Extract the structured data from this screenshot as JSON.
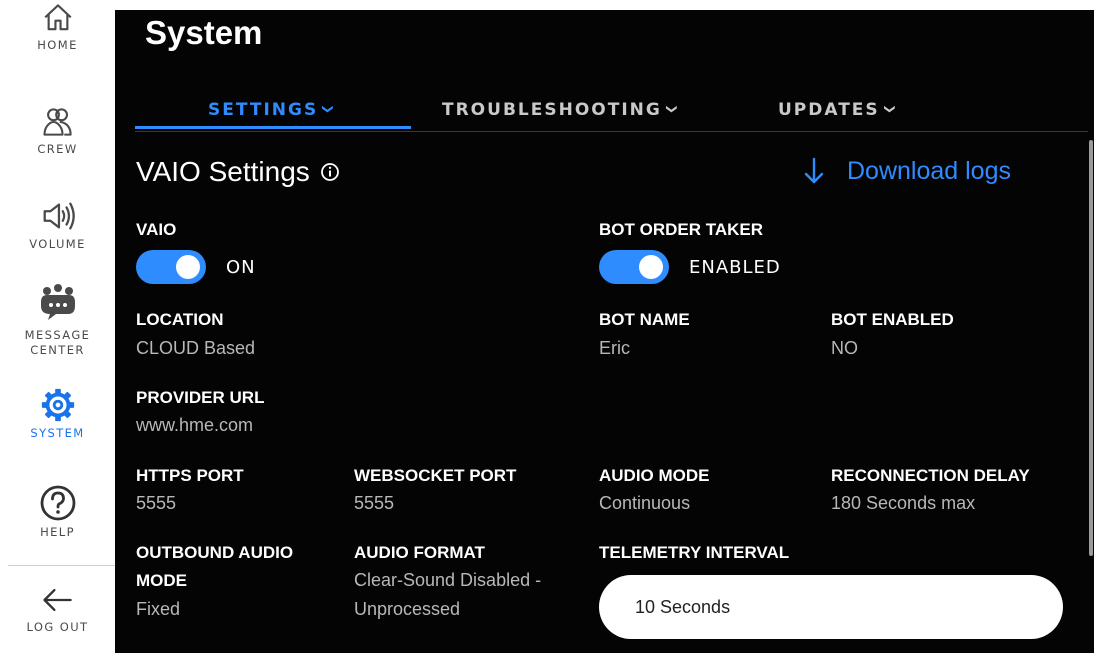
{
  "sidebar": {
    "items": [
      {
        "label": "HOME",
        "icon": "home-icon"
      },
      {
        "label": "CREW",
        "icon": "crew-icon"
      },
      {
        "label": "VOLUME",
        "icon": "volume-icon"
      },
      {
        "label_line1": "MESSAGE",
        "label_line2": "CENTER",
        "icon": "message-center-icon"
      },
      {
        "label": "SYSTEM",
        "icon": "gear-icon",
        "active": true
      },
      {
        "label": "HELP",
        "icon": "help-icon"
      },
      {
        "label": "LOG OUT",
        "icon": "arrow-left-icon"
      }
    ]
  },
  "header": {
    "title": "System"
  },
  "tabs": [
    {
      "label": "SETTINGS",
      "active": true
    },
    {
      "label": "TROUBLESHOOTING"
    },
    {
      "label": "UPDATES"
    }
  ],
  "section": {
    "title": "VAIO Settings",
    "download_label": "Download logs"
  },
  "vaio": {
    "label": "VAIO",
    "state": "ON"
  },
  "bot_order_taker": {
    "label": "BOT ORDER TAKER",
    "state": "ENABLED"
  },
  "location": {
    "label": "LOCATION",
    "value": "CLOUD Based"
  },
  "bot_name": {
    "label": "BOT NAME",
    "value": "Eric"
  },
  "bot_enabled": {
    "label": "BOT ENABLED",
    "value": "NO"
  },
  "provider_url": {
    "label": "PROVIDER URL",
    "value": "www.hme.com"
  },
  "https_port": {
    "label": "HTTPS PORT",
    "value": "5555"
  },
  "websocket_port": {
    "label": "WEBSOCKET PORT",
    "value": "5555"
  },
  "audio_mode": {
    "label": "AUDIO MODE",
    "value": "Continuous"
  },
  "reconnection_delay": {
    "label": "RECONNECTION DELAY",
    "value": "180 Seconds max"
  },
  "outbound_audio_mode": {
    "label_line1": "OUTBOUND AUDIO",
    "label_line2": "MODE",
    "value": "Fixed"
  },
  "audio_format": {
    "label": "AUDIO FORMAT",
    "value_line1": "Clear-Sound Disabled -",
    "value_line2": "Unprocessed"
  },
  "telemetry_interval": {
    "label": "TELEMETRY INTERVAL",
    "value": "10 Seconds"
  },
  "colors": {
    "accent": "#2f8cff",
    "background": "#040404",
    "sidebar": "#ffffff"
  }
}
